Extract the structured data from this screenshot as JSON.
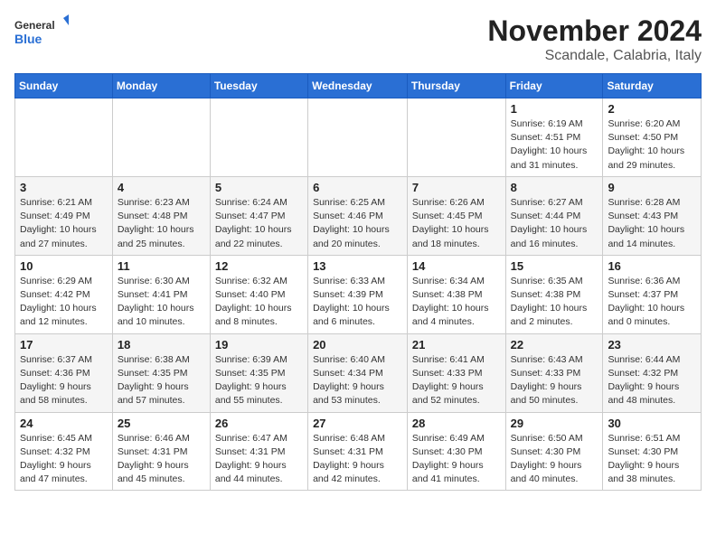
{
  "header": {
    "logo_general": "General",
    "logo_blue": "Blue",
    "month_title": "November 2024",
    "subtitle": "Scandale, Calabria, Italy"
  },
  "weekdays": [
    "Sunday",
    "Monday",
    "Tuesday",
    "Wednesday",
    "Thursday",
    "Friday",
    "Saturday"
  ],
  "weeks": [
    [
      {
        "day": "",
        "info": ""
      },
      {
        "day": "",
        "info": ""
      },
      {
        "day": "",
        "info": ""
      },
      {
        "day": "",
        "info": ""
      },
      {
        "day": "",
        "info": ""
      },
      {
        "day": "1",
        "info": "Sunrise: 6:19 AM\nSunset: 4:51 PM\nDaylight: 10 hours and 31 minutes."
      },
      {
        "day": "2",
        "info": "Sunrise: 6:20 AM\nSunset: 4:50 PM\nDaylight: 10 hours and 29 minutes."
      }
    ],
    [
      {
        "day": "3",
        "info": "Sunrise: 6:21 AM\nSunset: 4:49 PM\nDaylight: 10 hours and 27 minutes."
      },
      {
        "day": "4",
        "info": "Sunrise: 6:23 AM\nSunset: 4:48 PM\nDaylight: 10 hours and 25 minutes."
      },
      {
        "day": "5",
        "info": "Sunrise: 6:24 AM\nSunset: 4:47 PM\nDaylight: 10 hours and 22 minutes."
      },
      {
        "day": "6",
        "info": "Sunrise: 6:25 AM\nSunset: 4:46 PM\nDaylight: 10 hours and 20 minutes."
      },
      {
        "day": "7",
        "info": "Sunrise: 6:26 AM\nSunset: 4:45 PM\nDaylight: 10 hours and 18 minutes."
      },
      {
        "day": "8",
        "info": "Sunrise: 6:27 AM\nSunset: 4:44 PM\nDaylight: 10 hours and 16 minutes."
      },
      {
        "day": "9",
        "info": "Sunrise: 6:28 AM\nSunset: 4:43 PM\nDaylight: 10 hours and 14 minutes."
      }
    ],
    [
      {
        "day": "10",
        "info": "Sunrise: 6:29 AM\nSunset: 4:42 PM\nDaylight: 10 hours and 12 minutes."
      },
      {
        "day": "11",
        "info": "Sunrise: 6:30 AM\nSunset: 4:41 PM\nDaylight: 10 hours and 10 minutes."
      },
      {
        "day": "12",
        "info": "Sunrise: 6:32 AM\nSunset: 4:40 PM\nDaylight: 10 hours and 8 minutes."
      },
      {
        "day": "13",
        "info": "Sunrise: 6:33 AM\nSunset: 4:39 PM\nDaylight: 10 hours and 6 minutes."
      },
      {
        "day": "14",
        "info": "Sunrise: 6:34 AM\nSunset: 4:38 PM\nDaylight: 10 hours and 4 minutes."
      },
      {
        "day": "15",
        "info": "Sunrise: 6:35 AM\nSunset: 4:38 PM\nDaylight: 10 hours and 2 minutes."
      },
      {
        "day": "16",
        "info": "Sunrise: 6:36 AM\nSunset: 4:37 PM\nDaylight: 10 hours and 0 minutes."
      }
    ],
    [
      {
        "day": "17",
        "info": "Sunrise: 6:37 AM\nSunset: 4:36 PM\nDaylight: 9 hours and 58 minutes."
      },
      {
        "day": "18",
        "info": "Sunrise: 6:38 AM\nSunset: 4:35 PM\nDaylight: 9 hours and 57 minutes."
      },
      {
        "day": "19",
        "info": "Sunrise: 6:39 AM\nSunset: 4:35 PM\nDaylight: 9 hours and 55 minutes."
      },
      {
        "day": "20",
        "info": "Sunrise: 6:40 AM\nSunset: 4:34 PM\nDaylight: 9 hours and 53 minutes."
      },
      {
        "day": "21",
        "info": "Sunrise: 6:41 AM\nSunset: 4:33 PM\nDaylight: 9 hours and 52 minutes."
      },
      {
        "day": "22",
        "info": "Sunrise: 6:43 AM\nSunset: 4:33 PM\nDaylight: 9 hours and 50 minutes."
      },
      {
        "day": "23",
        "info": "Sunrise: 6:44 AM\nSunset: 4:32 PM\nDaylight: 9 hours and 48 minutes."
      }
    ],
    [
      {
        "day": "24",
        "info": "Sunrise: 6:45 AM\nSunset: 4:32 PM\nDaylight: 9 hours and 47 minutes."
      },
      {
        "day": "25",
        "info": "Sunrise: 6:46 AM\nSunset: 4:31 PM\nDaylight: 9 hours and 45 minutes."
      },
      {
        "day": "26",
        "info": "Sunrise: 6:47 AM\nSunset: 4:31 PM\nDaylight: 9 hours and 44 minutes."
      },
      {
        "day": "27",
        "info": "Sunrise: 6:48 AM\nSunset: 4:31 PM\nDaylight: 9 hours and 42 minutes."
      },
      {
        "day": "28",
        "info": "Sunrise: 6:49 AM\nSunset: 4:30 PM\nDaylight: 9 hours and 41 minutes."
      },
      {
        "day": "29",
        "info": "Sunrise: 6:50 AM\nSunset: 4:30 PM\nDaylight: 9 hours and 40 minutes."
      },
      {
        "day": "30",
        "info": "Sunrise: 6:51 AM\nSunset: 4:30 PM\nDaylight: 9 hours and 38 minutes."
      }
    ]
  ]
}
